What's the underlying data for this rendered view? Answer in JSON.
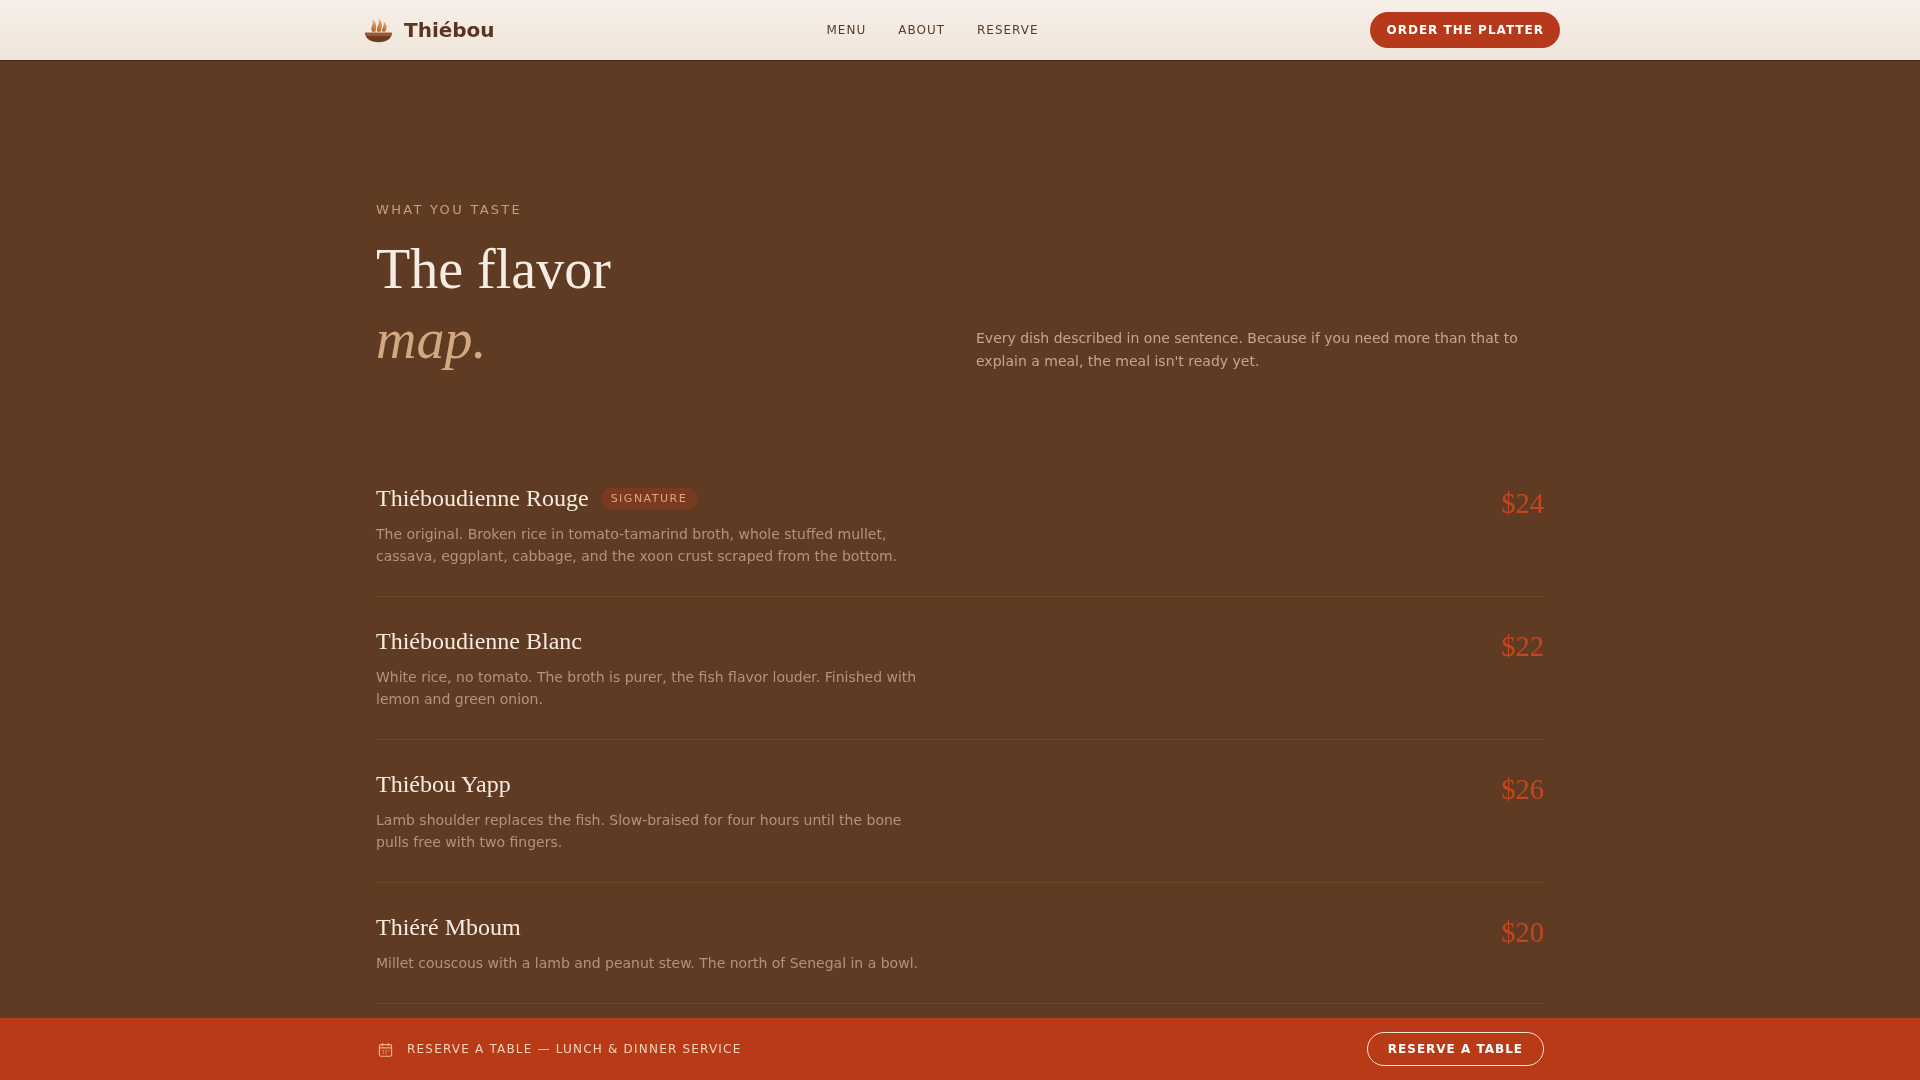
{
  "header": {
    "brand": "Thiébou",
    "nav": [
      "MENU",
      "ABOUT",
      "RESERVE"
    ],
    "cta": "ORDER THE PLATTER"
  },
  "intro": {
    "eyebrow": "WHAT YOU TASTE",
    "heading": "The flavor *map.*",
    "lede": "Every dish described in one sentence. Because if you need more than that to explain a meal, the meal isn't ready yet."
  },
  "dishes": [
    {
      "name": "Thiéboudienne Rouge",
      "badge": "SIGNATURE",
      "description": "The original. Broken rice in tomato-tamarind broth, whole stuffed mullet, cassava, eggplant, cabbage, and the xoon crust scraped from the bottom.",
      "price": "$24"
    },
    {
      "name": "Thiéboudienne Blanc",
      "description": "White rice, no tomato. The broth is purer, the fish flavor louder. Finished with lemon and green onion.",
      "price": "$22"
    },
    {
      "name": "Thiébou Yapp",
      "description": "Lamb shoulder replaces the fish. Slow-braised for four hours until the bone pulls free with two fingers.",
      "price": "$26"
    },
    {
      "name": "Thiéré Mboum",
      "description": "Millet couscous with a lamb and peanut stew. The north of Senegal in a bowl.",
      "price": "$20"
    }
  ],
  "reserve_bar": {
    "text": "RESERVE A TABLE — LUNCH & DINNER SERVICE",
    "button": "RESERVE A TABLE"
  }
}
